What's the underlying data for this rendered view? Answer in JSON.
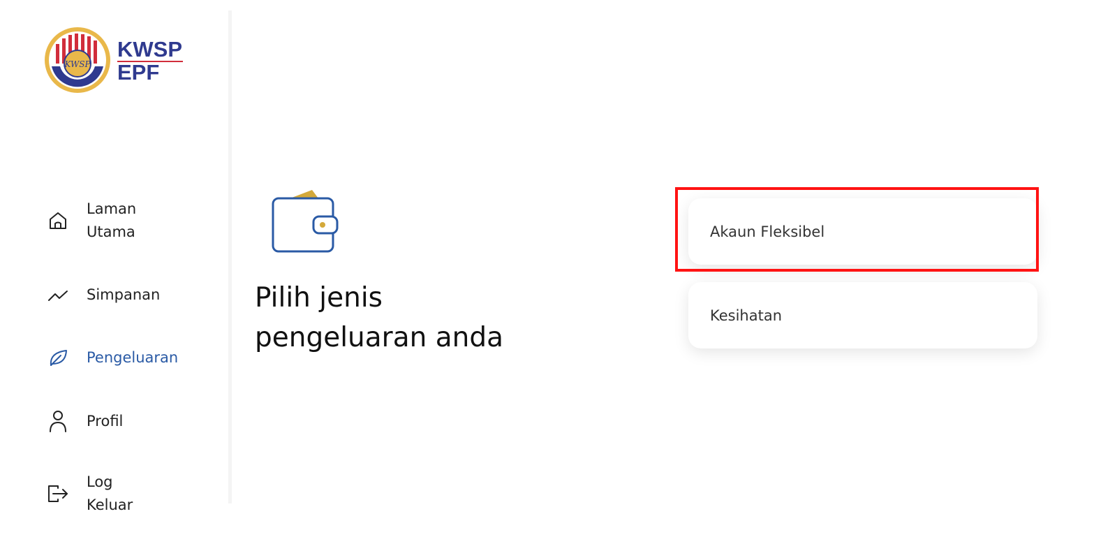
{
  "logo": {
    "line1": "KWSP",
    "line2": "EPF",
    "emblem_text": "KWSP"
  },
  "sidebar": {
    "items": [
      {
        "label": "Laman Utama",
        "icon": "home-icon",
        "active": false
      },
      {
        "label": "Simpanan",
        "icon": "trend-line-icon",
        "active": false
      },
      {
        "label": "Pengeluaran",
        "icon": "leaf-icon",
        "active": true
      },
      {
        "label": "Profil",
        "icon": "person-icon",
        "active": false
      },
      {
        "label": "Log Keluar",
        "icon": "logout-icon",
        "active": false
      }
    ]
  },
  "main": {
    "heading": "Pilih jenis pengeluaran anda",
    "icon": "wallet-icon",
    "options": [
      {
        "label": "Akaun Fleksibel",
        "highlighted": true
      },
      {
        "label": "Kesihatan",
        "highlighted": false
      }
    ]
  },
  "colors": {
    "brand_blue": "#2f3a8f",
    "brand_red": "#d12d3b",
    "active_nav": "#2a5aa5",
    "wallet_blue": "#2a5aa5",
    "wallet_gold": "#d4a93a",
    "highlight": "#ff1313"
  }
}
